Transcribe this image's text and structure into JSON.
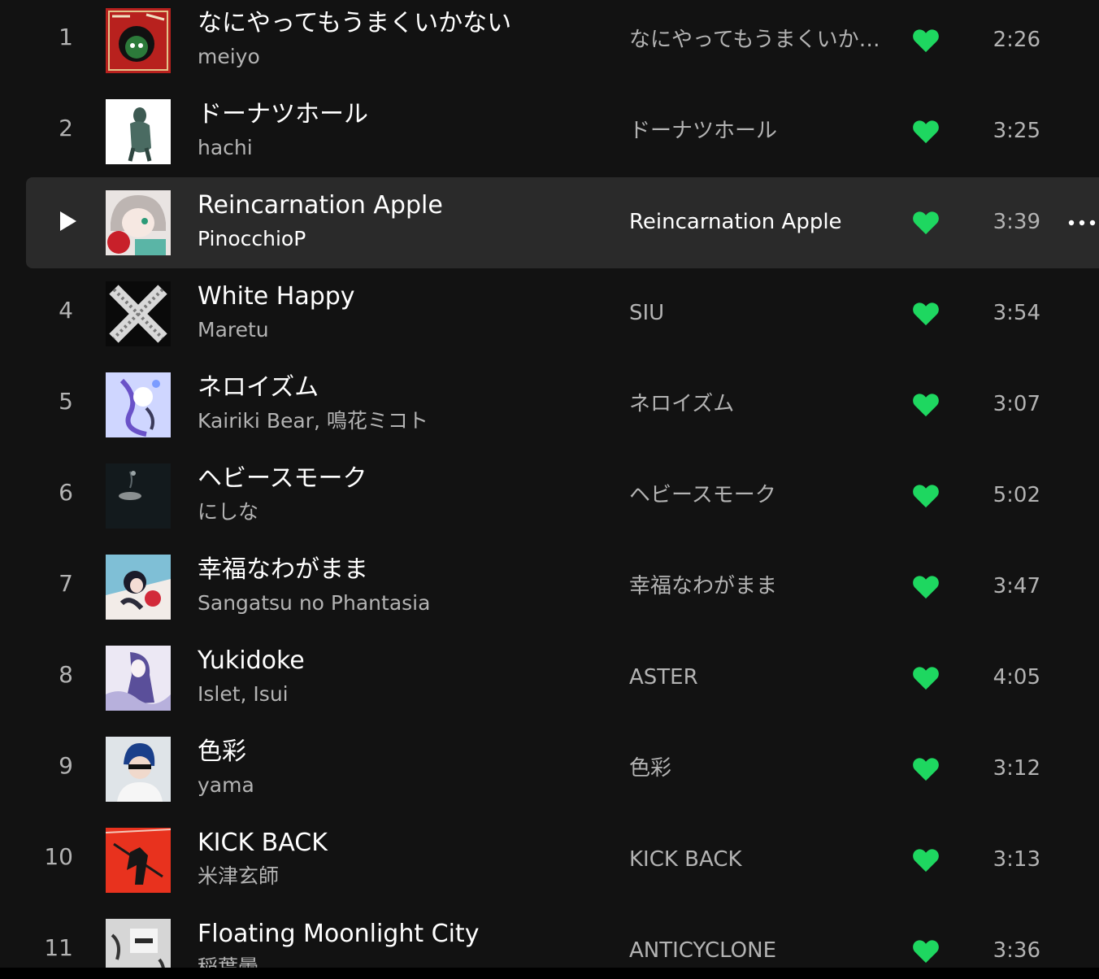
{
  "accent_color": "#1ed760",
  "tracks": [
    {
      "index": "1",
      "title": "なにやってもうまくいかない",
      "artist": "meiyo",
      "album": "なにやってもうまくいかない",
      "duration": "2:26",
      "liked": true,
      "active": false
    },
    {
      "index": "2",
      "title": "ドーナツホール",
      "artist": "hachi",
      "album": "ドーナツホール",
      "duration": "3:25",
      "liked": true,
      "active": false
    },
    {
      "index": "3",
      "title": "Reincarnation Apple",
      "artist": "PinocchioP",
      "album": "Reincarnation Apple",
      "duration": "3:39",
      "liked": true,
      "active": true
    },
    {
      "index": "4",
      "title": "White Happy",
      "artist": "Maretu",
      "album": "SIU",
      "duration": "3:54",
      "liked": true,
      "active": false
    },
    {
      "index": "5",
      "title": "ネロイズム",
      "artist": "Kairiki Bear, 鳴花ミコト",
      "album": "ネロイズム",
      "duration": "3:07",
      "liked": true,
      "active": false
    },
    {
      "index": "6",
      "title": "ヘビースモーク",
      "artist": "にしな",
      "album": "ヘビースモーク",
      "duration": "5:02",
      "liked": true,
      "active": false
    },
    {
      "index": "7",
      "title": "幸福なわがまま",
      "artist": "Sangatsu no Phantasia",
      "album": "幸福なわがまま",
      "duration": "3:47",
      "liked": true,
      "active": false
    },
    {
      "index": "8",
      "title": "Yukidoke",
      "artist": "Islet, Isui",
      "album": "ASTER",
      "duration": "4:05",
      "liked": true,
      "active": false
    },
    {
      "index": "9",
      "title": "色彩",
      "artist": "yama",
      "album": "色彩",
      "duration": "3:12",
      "liked": true,
      "active": false
    },
    {
      "index": "10",
      "title": "KICK BACK",
      "artist": "米津玄師",
      "album": "KICK BACK",
      "duration": "3:13",
      "liked": true,
      "active": false
    },
    {
      "index": "11",
      "title": "Floating Moonlight City",
      "artist": "稲葉曇",
      "album": "ANTICYCLONE",
      "duration": "3:36",
      "liked": true,
      "active": false
    }
  ]
}
